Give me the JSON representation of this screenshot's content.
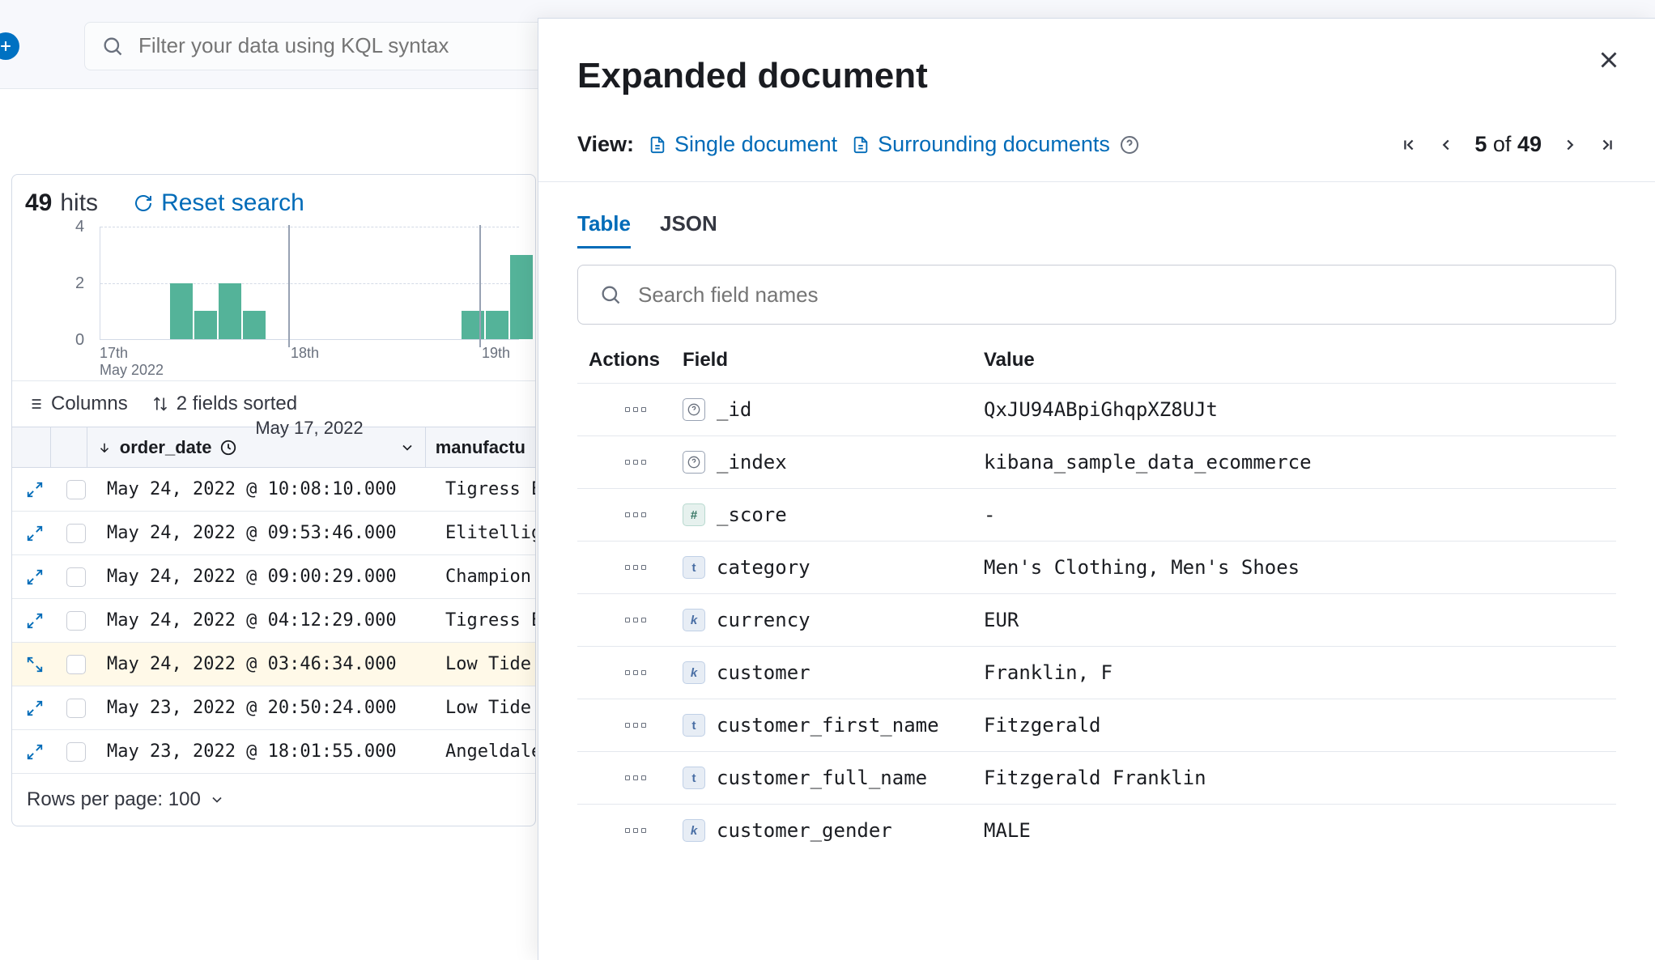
{
  "filter": {
    "placeholder": "Filter your data using KQL syntax"
  },
  "hits": {
    "count": "49",
    "label": "hits",
    "reset": "Reset search"
  },
  "chart_data": {
    "type": "bar",
    "title": "",
    "xlabel": "May 17, 2022",
    "ylabel": "",
    "ylim": [
      0,
      4
    ],
    "x_ticks": [
      "17th",
      "May 2022",
      "18th",
      "19th"
    ],
    "y_ticks": [
      "0",
      "2",
      "4"
    ],
    "series": [
      {
        "name": "hits",
        "values": [
          0,
          2,
          1,
          2,
          1,
          0,
          0,
          0,
          0,
          0,
          1,
          1,
          3
        ]
      }
    ]
  },
  "controls": {
    "columns": "Columns",
    "sorted": "2 fields sorted"
  },
  "table": {
    "headers": {
      "date": "order_date",
      "manufacturer": "manufactu"
    },
    "rows": [
      {
        "date": "May 24, 2022 @ 10:08:10.000",
        "manufacturer": "Tigress E",
        "selected": false
      },
      {
        "date": "May 24, 2022 @ 09:53:46.000",
        "manufacturer": "Elitellig",
        "selected": false
      },
      {
        "date": "May 24, 2022 @ 09:00:29.000",
        "manufacturer": "Champion",
        "selected": false
      },
      {
        "date": "May 24, 2022 @ 04:12:29.000",
        "manufacturer": "Tigress E",
        "selected": false
      },
      {
        "date": "May 24, 2022 @ 03:46:34.000",
        "manufacturer": "Low Tide",
        "selected": true
      },
      {
        "date": "May 23, 2022 @ 20:50:24.000",
        "manufacturer": "Low Tide",
        "selected": false
      },
      {
        "date": "May 23, 2022 @ 18:01:55.000",
        "manufacturer": "Angeldale",
        "selected": false
      }
    ],
    "footer": "Rows per page: 100"
  },
  "flyout": {
    "title": "Expanded document",
    "view_label": "View:",
    "single_doc": "Single document",
    "surrounding": "Surrounding documents",
    "pager": {
      "current": "5",
      "of": "of",
      "total": "49"
    },
    "tabs": {
      "table": "Table",
      "json": "JSON"
    },
    "search_placeholder": "Search field names",
    "headers": {
      "actions": "Actions",
      "field": "Field",
      "value": "Value"
    },
    "fields": [
      {
        "type": "meta",
        "icon": "?",
        "name": "_id",
        "value": "QxJU94ABpiGhqpXZ8UJt"
      },
      {
        "type": "meta",
        "icon": "?",
        "name": "_index",
        "value": "kibana_sample_data_ecommerce"
      },
      {
        "type": "num",
        "icon": "#",
        "name": "_score",
        "value": "-"
      },
      {
        "type": "text",
        "icon": "t",
        "name": "category",
        "value": "Men's Clothing, Men's Shoes"
      },
      {
        "type": "key",
        "icon": "k",
        "name": "currency",
        "value": "EUR"
      },
      {
        "type": "key",
        "icon": "k",
        "name": "customer",
        "value": "Franklin, F"
      },
      {
        "type": "text",
        "icon": "t",
        "name": "customer_first_name",
        "value": "Fitzgerald"
      },
      {
        "type": "text",
        "icon": "t",
        "name": "customer_full_name",
        "value": "Fitzgerald Franklin"
      },
      {
        "type": "key",
        "icon": "k",
        "name": "customer_gender",
        "value": "MALE"
      }
    ]
  }
}
